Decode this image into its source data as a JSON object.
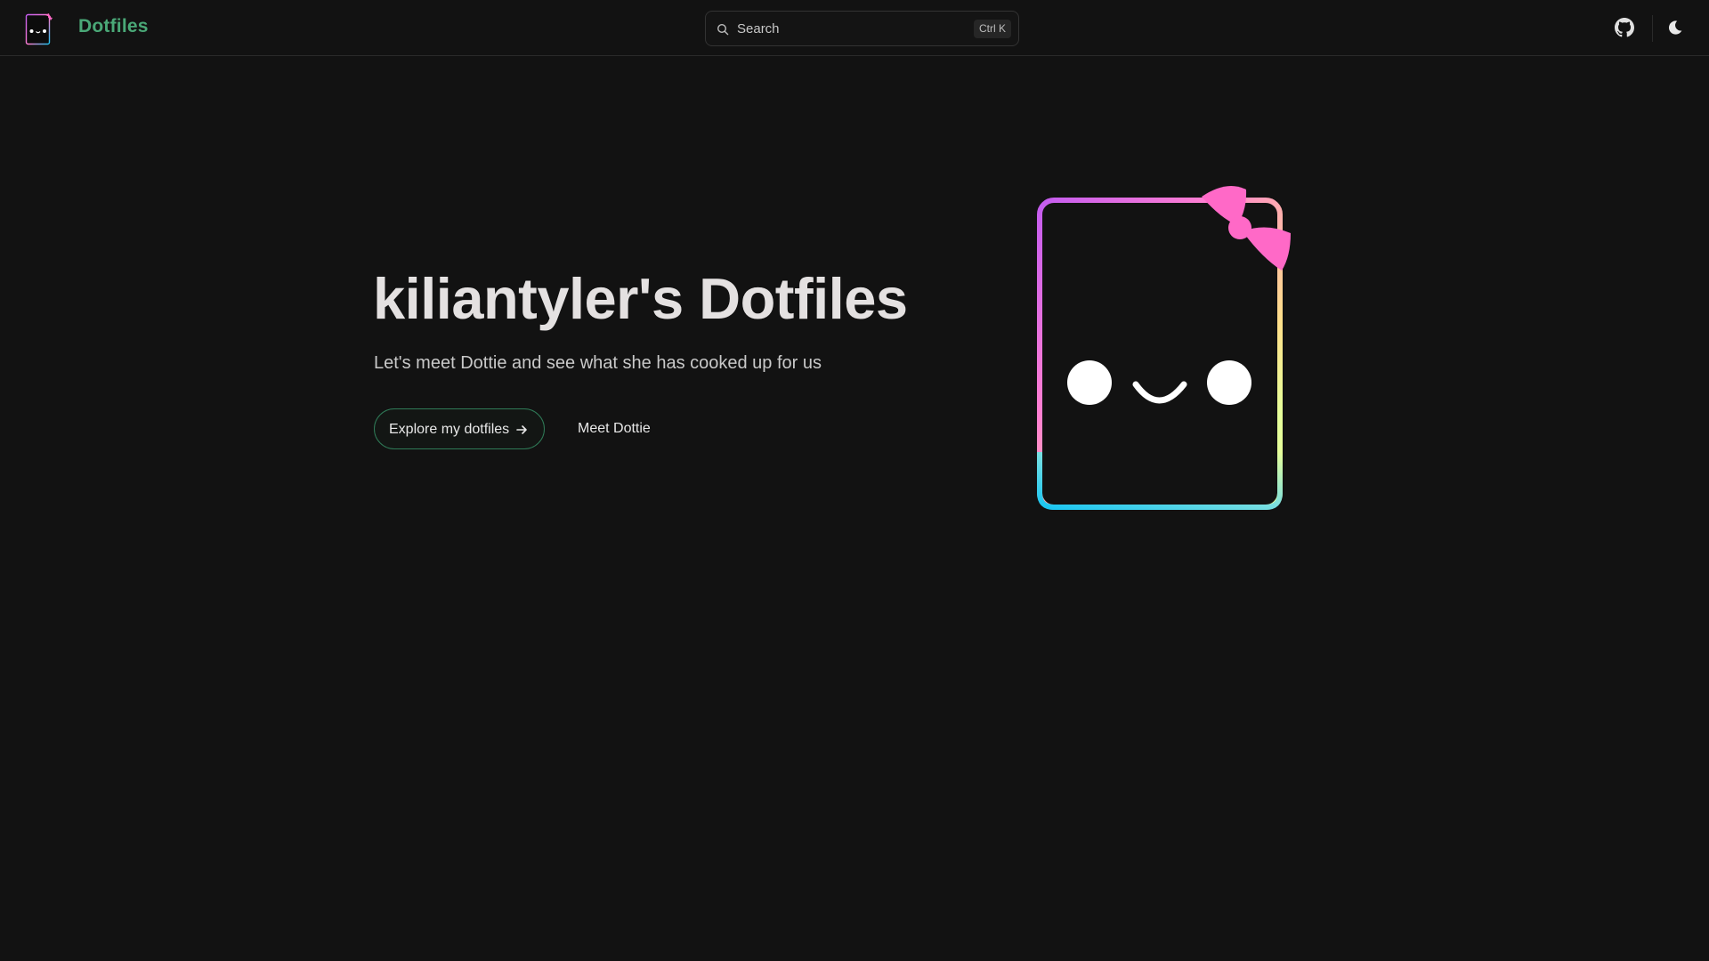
{
  "header": {
    "brand": "Dotfiles",
    "search": {
      "placeholder": "Search",
      "shortcut": "Ctrl K"
    },
    "icons": [
      "search-icon",
      "github-icon",
      "moon-icon"
    ]
  },
  "hero": {
    "title": "kiliantyler's Dotfiles",
    "subtitle": "Let's meet Dottie and see what she has cooked up for us",
    "primary_button": "Explore my dotfiles",
    "secondary_button": "Meet Dottie"
  },
  "colors": {
    "background": "#121212",
    "brand": "#4aa877",
    "bow": "#ff69c7",
    "gradient": [
      "#c45cf0",
      "#ff7fd1",
      "#ffe08a",
      "#e6ff9a",
      "#19c6f2"
    ]
  }
}
